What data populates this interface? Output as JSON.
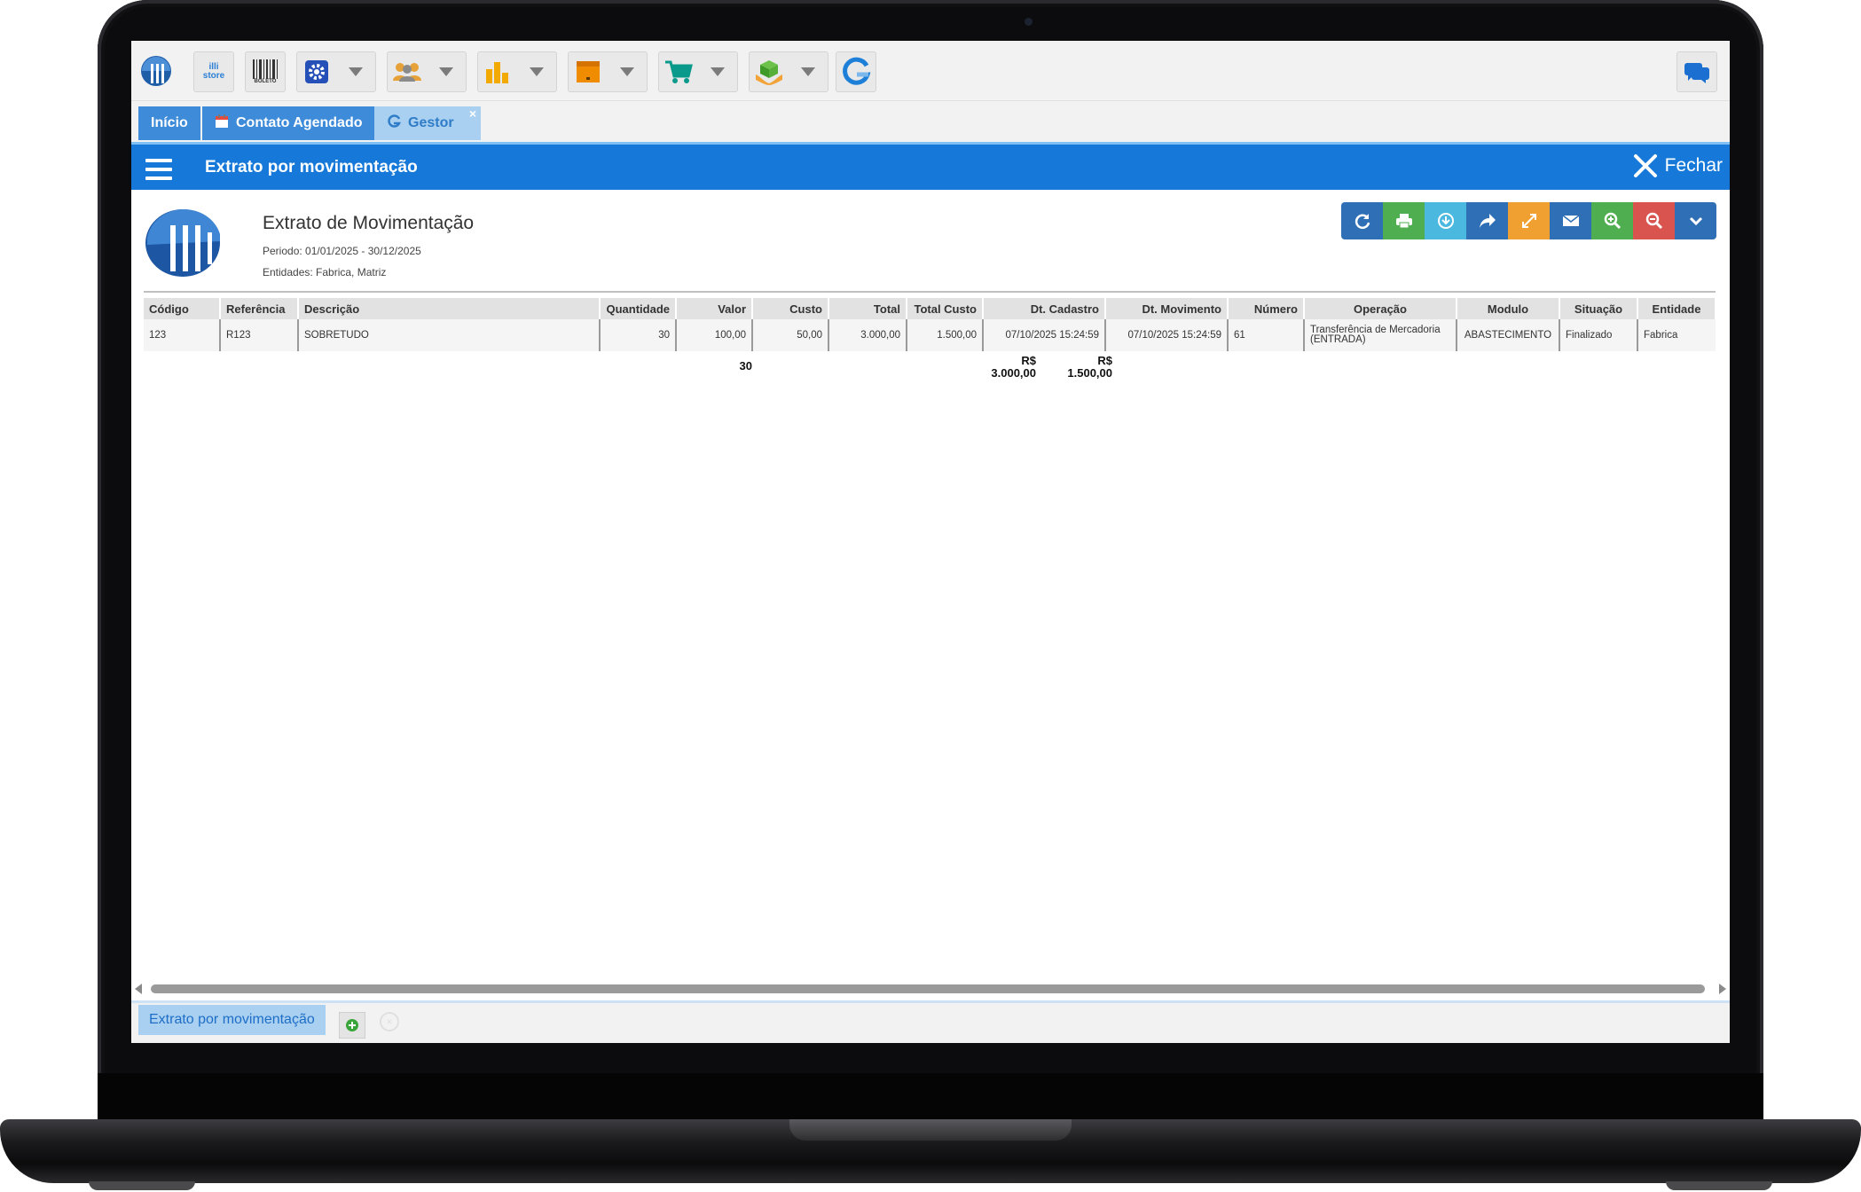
{
  "tabs": [
    {
      "label": "Início"
    },
    {
      "label": "Contato Agendado"
    },
    {
      "label": "Gestor"
    }
  ],
  "toolbar": {
    "store_label": "illi store",
    "boleto_label": "BOLETO"
  },
  "header": {
    "title": "Extrato por movimentação",
    "close_label": "Fechar"
  },
  "report": {
    "title": "Extrato de Movimentação",
    "period": "Periodo: 01/01/2025 - 30/12/2025",
    "entities": "Entidades: Fabrica, Matriz"
  },
  "table": {
    "headers": [
      "Código",
      "Referência",
      "Descrição",
      "Quantidade",
      "Valor",
      "Custo",
      "Total",
      "Total Custo",
      "Dt. Cadastro",
      "Dt. Movimento",
      "Número",
      "Operação",
      "Modulo",
      "Situação",
      "Entidade"
    ],
    "rows": [
      [
        "123",
        "R123",
        "SOBRETUDO",
        "30",
        "100,00",
        "50,00",
        "3.000,00",
        "1.500,00",
        "07/10/2025 15:24:59",
        "07/10/2025 15:24:59",
        "61",
        "Transferência de Mercadoria (ENTRADA)",
        "ABASTECIMENTO",
        "Finalizado",
        "Fabrica"
      ]
    ],
    "totals": {
      "quantidade": "30",
      "total_currency": "R$",
      "total_value": "3.000,00",
      "total_custo_currency": "R$",
      "total_custo_value": "1.500,00"
    }
  },
  "bottom": {
    "tab_label": "Extrato por movimentação"
  },
  "colors": {
    "header_blue": "#1679d9",
    "tab_blue": "#3d8bd9",
    "active_tab": "#a9d0f0"
  }
}
